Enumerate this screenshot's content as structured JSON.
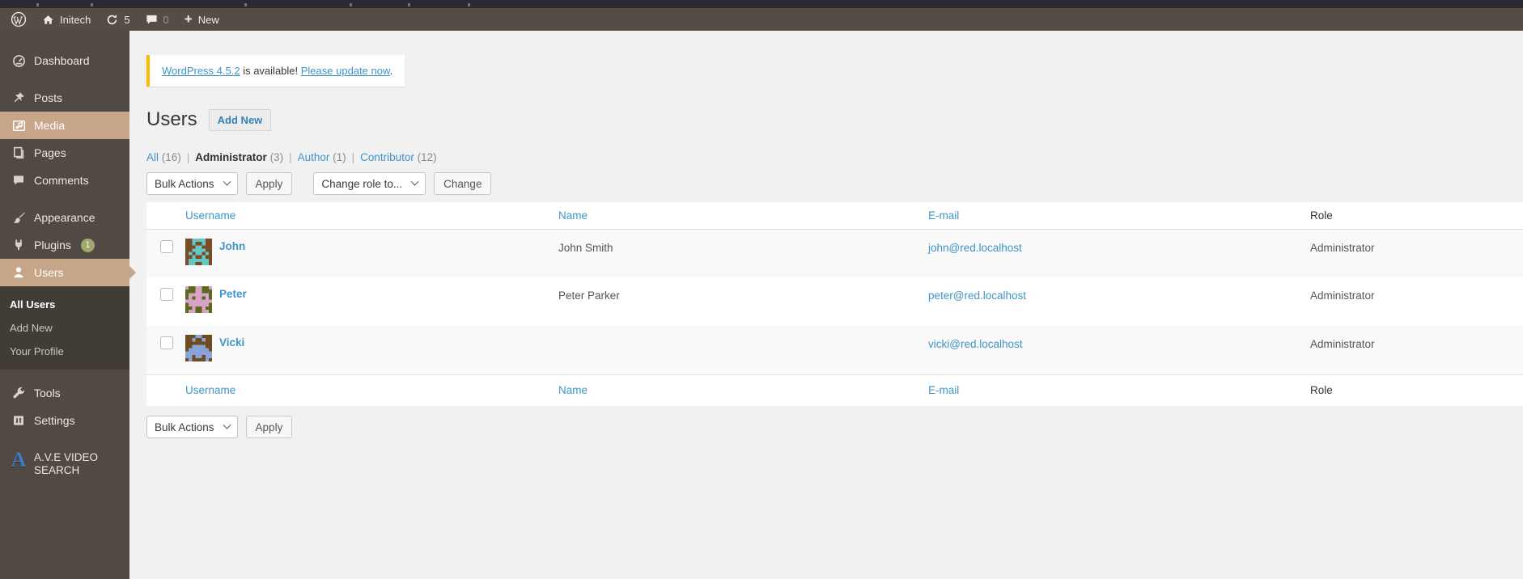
{
  "colors": {
    "accent": "#c7a589",
    "link": "#3f95c8",
    "notice_border": "#ffba00",
    "badge": "#9fa86e",
    "sidebar_bg": "#514a44",
    "submenu_bg": "#423c37"
  },
  "admin_bar": {
    "site_name": "Initech",
    "update_count": "5",
    "comment_count": "0",
    "new_label": "New"
  },
  "sidebar": {
    "items": [
      {
        "id": "dashboard",
        "label": "Dashboard",
        "icon": "dashboard"
      },
      {
        "id": "posts",
        "label": "Posts",
        "icon": "pin",
        "gap_before": true
      },
      {
        "id": "media",
        "label": "Media",
        "icon": "media",
        "state": "hover"
      },
      {
        "id": "pages",
        "label": "Pages",
        "icon": "pages"
      },
      {
        "id": "comments",
        "label": "Comments",
        "icon": "comments"
      },
      {
        "id": "appearance",
        "label": "Appearance",
        "icon": "brush",
        "gap_before": true
      },
      {
        "id": "plugins",
        "label": "Plugins",
        "icon": "plug",
        "badge": "1"
      },
      {
        "id": "users",
        "label": "Users",
        "icon": "user",
        "state": "current",
        "submenu": [
          {
            "label": "All Users",
            "current": true
          },
          {
            "label": "Add New",
            "current": false
          },
          {
            "label": "Your Profile",
            "current": false
          }
        ]
      },
      {
        "id": "tools",
        "label": "Tools",
        "icon": "wrench",
        "gap_before": true
      },
      {
        "id": "settings",
        "label": "Settings",
        "icon": "settings"
      },
      {
        "id": "ave-video-search",
        "label": "A.V.E VIDEO SEARCH",
        "icon": "ave",
        "gap_before": true
      }
    ]
  },
  "notice": {
    "link1": "WordPress 4.5.2",
    "middle": " is available! ",
    "link2": "Please update now",
    "end": "."
  },
  "page": {
    "title": "Users",
    "add_new": "Add New",
    "filters": [
      {
        "label": "All",
        "count": "(16)",
        "current": false
      },
      {
        "label": "Administrator",
        "count": "(3)",
        "current": true
      },
      {
        "label": "Author",
        "count": "(1)",
        "current": false
      },
      {
        "label": "Contributor",
        "count": "(12)",
        "current": false
      }
    ],
    "bulk_top": {
      "select": "Bulk Actions",
      "apply": "Apply",
      "role_select": "Change role to...",
      "change": "Change"
    },
    "bulk_bottom": {
      "select": "Bulk Actions",
      "apply": "Apply"
    },
    "table": {
      "columns": [
        {
          "label": "Username",
          "sortable": true
        },
        {
          "label": "Name",
          "sortable": true
        },
        {
          "label": "E-mail",
          "sortable": true
        },
        {
          "label": "Role",
          "sortable": false
        }
      ],
      "users": [
        {
          "username": "John",
          "name": "John Smith",
          "email": "john@red.localhost",
          "role": "Administrator",
          "avatar": {
            "bg": "#7a4b24",
            "fg": "#63c7c5",
            "pattern": [
              "..XXXX..",
              "..X..X..",
              "...XX...",
              "..XXXX..",
              ".X.XX.X.",
              "..X..X..",
              ".XXXXXX.",
              ".XX..XX."
            ]
          }
        },
        {
          "username": "Peter",
          "name": "Peter Parker",
          "email": "peter@red.localhost",
          "role": "Administrator",
          "avatar": {
            "bg": "#5a691c",
            "fg": "#d9a3c5",
            "pattern": [
              "X..XX..X",
              "...XX...",
              ".XXXXXX.",
              ".X.XX.X.",
              "XXXXXXXX",
              ".XXXXXX.",
              "..X..X..",
              ".XX..XX."
            ]
          }
        },
        {
          "username": "Vicki",
          "name": "",
          "email": "vicki@red.localhost",
          "role": "Administrator",
          "avatar": {
            "bg": "#6f4c20",
            "fg": "#8ba3d8",
            "pattern": [
              "...XX...",
              "..X..X..",
              "........",
              "..XXXX..",
              ".XXXXXX.",
              "XXXXXXXX",
              "XX.XX.XX",
              ".X....X."
            ]
          }
        }
      ]
    }
  }
}
